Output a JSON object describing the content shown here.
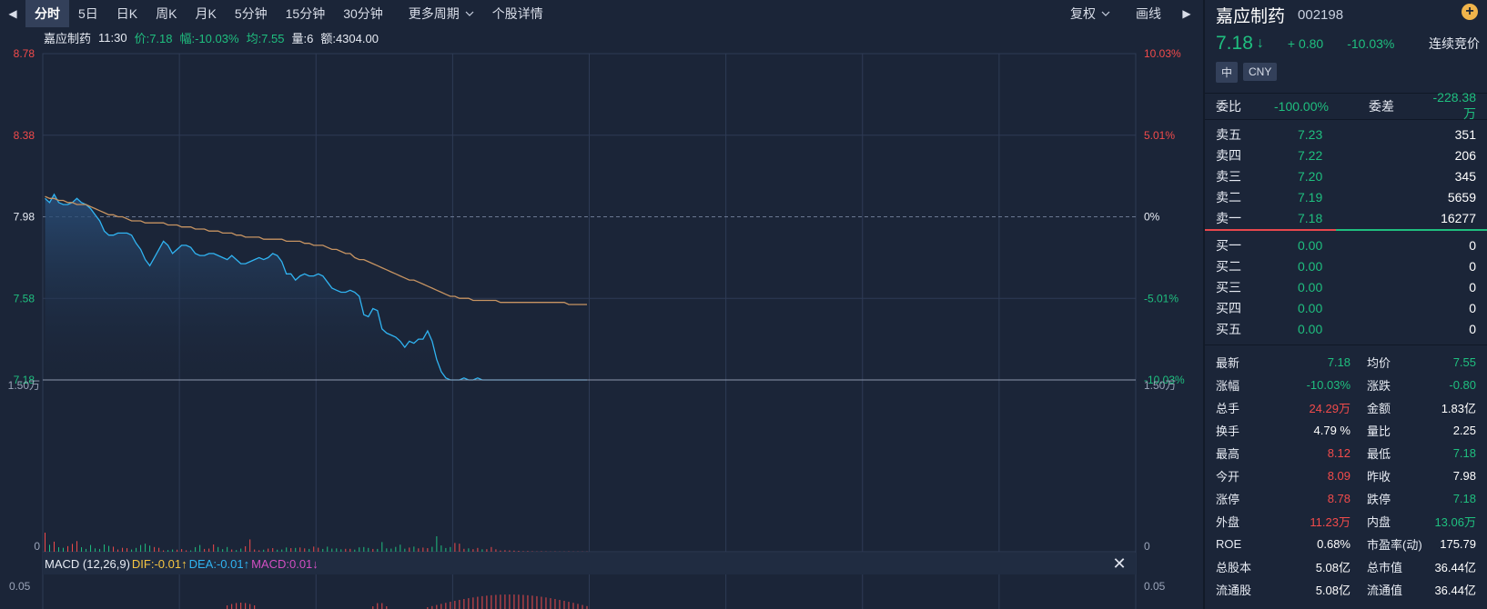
{
  "toolbar": {
    "prev_arrow": "◀",
    "tabs": [
      "分时",
      "5日",
      "日K",
      "周K",
      "月K",
      "5分钟",
      "15分钟",
      "30分钟"
    ],
    "active_tab": 0,
    "more_periods": "更多周期",
    "stock_detail": "个股详情",
    "adjust": "复权",
    "draw": "画线",
    "next_arrow": "▶"
  },
  "infoline": {
    "name": "嘉应制药",
    "time": "11:30",
    "price_label": "价:7.18",
    "change_label": "幅:-10.03%",
    "avg_label": "均:7.55",
    "vol_label": "量:6",
    "amount_label": "额:4304.00"
  },
  "chart_data": {
    "type": "line",
    "title": "",
    "price_axis": {
      "ticks": [
        "8.78",
        "8.38",
        "7.98",
        "7.58",
        "7.18"
      ],
      "tick_colors": [
        "#f24b4b",
        "#f24b4b",
        "#e7ebf3",
        "#1fbf7f",
        "#1fbf7f"
      ],
      "ylim": [
        7.18,
        8.78
      ],
      "prev_close": 7.98
    },
    "pct_axis": {
      "ticks": [
        "10.03%",
        "5.01%",
        "0%",
        "-5.01%",
        "-10.03%"
      ]
    },
    "volume_axis": {
      "ticks": [
        "1.50万",
        "0"
      ]
    },
    "macd_axis": {
      "ticks": [
        "0.05"
      ]
    },
    "x_session_minutes": 240,
    "series": [
      {
        "name": "价",
        "color": "#30b4f2",
        "values": [
          8.07,
          8.05,
          8.09,
          8.05,
          8.04,
          8.04,
          8.05,
          8.07,
          8.05,
          8.04,
          8.02,
          7.99,
          7.96,
          7.91,
          7.89,
          7.89,
          7.9,
          7.9,
          7.9,
          7.89,
          7.85,
          7.82,
          7.77,
          7.74,
          7.78,
          7.82,
          7.86,
          7.84,
          7.8,
          7.82,
          7.84,
          7.84,
          7.83,
          7.8,
          7.79,
          7.79,
          7.8,
          7.8,
          7.79,
          7.78,
          7.77,
          7.79,
          7.77,
          7.75,
          7.75,
          7.76,
          7.77,
          7.78,
          7.77,
          7.78,
          7.8,
          7.79,
          7.76,
          7.7,
          7.7,
          7.67,
          7.69,
          7.7,
          7.69,
          7.69,
          7.7,
          7.69,
          7.66,
          7.63,
          7.62,
          7.61,
          7.61,
          7.62,
          7.61,
          7.59,
          7.5,
          7.49,
          7.53,
          7.52,
          7.43,
          7.41,
          7.4,
          7.39,
          7.37,
          7.34,
          7.37,
          7.36,
          7.38,
          7.38,
          7.42,
          7.37,
          7.28,
          7.22,
          7.19,
          7.18,
          7.18,
          7.18,
          7.19,
          7.18,
          7.18,
          7.19,
          7.18,
          7.18,
          7.18,
          7.18,
          7.18,
          7.18,
          7.18,
          7.18,
          7.18,
          7.18,
          7.18,
          7.18,
          7.18,
          7.18,
          7.18,
          7.18,
          7.18,
          7.18,
          7.18,
          7.18,
          7.18,
          7.18,
          7.18,
          7.18
        ]
      },
      {
        "name": "均",
        "color": "#c79462",
        "values": [
          8.08,
          8.07,
          8.07,
          8.06,
          8.06,
          8.05,
          8.05,
          8.04,
          8.04,
          8.04,
          8.03,
          8.02,
          8.01,
          8.0,
          7.99,
          7.99,
          7.98,
          7.98,
          7.97,
          7.96,
          7.96,
          7.96,
          7.95,
          7.95,
          7.95,
          7.95,
          7.95,
          7.94,
          7.94,
          7.94,
          7.93,
          7.93,
          7.93,
          7.92,
          7.92,
          7.92,
          7.91,
          7.91,
          7.91,
          7.9,
          7.9,
          7.9,
          7.89,
          7.89,
          7.88,
          7.88,
          7.88,
          7.88,
          7.87,
          7.87,
          7.87,
          7.87,
          7.87,
          7.86,
          7.86,
          7.86,
          7.86,
          7.85,
          7.85,
          7.84,
          7.84,
          7.84,
          7.83,
          7.82,
          7.82,
          7.81,
          7.8,
          7.8,
          7.78,
          7.77,
          7.77,
          7.76,
          7.75,
          7.74,
          7.73,
          7.72,
          7.71,
          7.7,
          7.69,
          7.68,
          7.67,
          7.67,
          7.66,
          7.65,
          7.64,
          7.63,
          7.62,
          7.61,
          7.6,
          7.59,
          7.59,
          7.58,
          7.58,
          7.58,
          7.57,
          7.57,
          7.57,
          7.57,
          7.57,
          7.57,
          7.56,
          7.56,
          7.56,
          7.56,
          7.56,
          7.56,
          7.56,
          7.56,
          7.56,
          7.56,
          7.56,
          7.56,
          7.56,
          7.56,
          7.56,
          7.55,
          7.55,
          7.55,
          7.55,
          7.55
        ]
      }
    ],
    "volume": {
      "unit_max": 15000,
      "values": [
        1700,
        620,
        900,
        400,
        350,
        500,
        700,
        950,
        400,
        250,
        600,
        300,
        250,
        650,
        520,
        450,
        200,
        350,
        320,
        200,
        340,
        600,
        720,
        550,
        420,
        350,
        120,
        150,
        200,
        180,
        240,
        130,
        120,
        410,
        600,
        250,
        280,
        650,
        420,
        230,
        420,
        200,
        150,
        280,
        490,
        1100,
        200,
        130,
        180,
        280,
        320,
        180,
        200,
        380,
        320,
        340,
        380,
        300,
        250,
        460,
        360,
        250,
        450,
        280,
        300,
        220,
        260,
        260,
        190,
        390,
        420,
        340,
        250,
        250,
        860,
        300,
        280,
        430,
        630,
        270,
        370,
        460,
        300,
        370,
        320,
        440,
        1380,
        560,
        330,
        420,
        780,
        720,
        260,
        300,
        230,
        340,
        220,
        230,
        420,
        220,
        110,
        140,
        120,
        100,
        80,
        50,
        60,
        40,
        30,
        40,
        30,
        20,
        30,
        20,
        20,
        30,
        20,
        20,
        20,
        20
      ]
    },
    "macd": {
      "label": "MACD (12,26,9)",
      "dif": "DIF:-0.01↑",
      "dea": "DEA:-0.01↑",
      "macd": "MACD:0.01↓"
    },
    "grid": true
  },
  "panel": {
    "name": "嘉应制药",
    "code": "002198",
    "price": "7.18",
    "price_arrow": "↓",
    "change": "+ 0.80",
    "change_pct": "-10.03%",
    "status": "连续竞价",
    "tags": [
      "中",
      "CNY"
    ],
    "weibi_label": "委比",
    "weibi_value": "-100.00%",
    "weicha_label": "委差",
    "weicha_value": "-228.38万",
    "asks": [
      {
        "label": "卖五",
        "price": "7.23",
        "vol": "351"
      },
      {
        "label": "卖四",
        "price": "7.22",
        "vol": "206"
      },
      {
        "label": "卖三",
        "price": "7.20",
        "vol": "345"
      },
      {
        "label": "卖二",
        "price": "7.19",
        "vol": "5659"
      },
      {
        "label": "卖一",
        "price": "7.18",
        "vol": "16277"
      }
    ],
    "bids": [
      {
        "label": "买一",
        "price": "0.00",
        "vol": "0"
      },
      {
        "label": "买二",
        "price": "0.00",
        "vol": "0"
      },
      {
        "label": "买三",
        "price": "0.00",
        "vol": "0"
      },
      {
        "label": "买四",
        "price": "0.00",
        "vol": "0"
      },
      {
        "label": "买五",
        "price": "0.00",
        "vol": "0"
      }
    ],
    "stats": [
      {
        "l1": "最新",
        "v1": "7.18",
        "c1": "grn",
        "l2": "均价",
        "v2": "7.55",
        "c2": "grn"
      },
      {
        "l1": "涨幅",
        "v1": "-10.03%",
        "c1": "grn",
        "l2": "涨跌",
        "v2": "-0.80",
        "c2": "grn"
      },
      {
        "l1": "总手",
        "v1": "24.29万",
        "c1": "red",
        "l2": "金额",
        "v2": "1.83亿",
        "c2": "wht"
      },
      {
        "l1": "换手",
        "v1": "4.79 %",
        "c1": "wht",
        "l2": "量比",
        "v2": "2.25",
        "c2": "wht"
      },
      {
        "l1": "最高",
        "v1": "8.12",
        "c1": "red",
        "l2": "最低",
        "v2": "7.18",
        "c2": "grn"
      },
      {
        "l1": "今开",
        "v1": "8.09",
        "c1": "red",
        "l2": "昨收",
        "v2": "7.98",
        "c2": "wht"
      },
      {
        "l1": "涨停",
        "v1": "8.78",
        "c1": "red",
        "l2": "跌停",
        "v2": "7.18",
        "c2": "grn"
      },
      {
        "l1": "外盘",
        "v1": "11.23万",
        "c1": "red",
        "l2": "内盘",
        "v2": "13.06万",
        "c2": "grn"
      },
      {
        "l1": "ROE",
        "v1": "0.68%",
        "c1": "wht",
        "l2": "市盈率(动)",
        "v2": "175.79",
        "c2": "wht"
      },
      {
        "l1": "总股本",
        "v1": "5.08亿",
        "c1": "wht",
        "l2": "总市值",
        "v2": "36.44亿",
        "c2": "wht"
      },
      {
        "l1": "流通股",
        "v1": "5.08亿",
        "c1": "wht",
        "l2": "流通值",
        "v2": "36.44亿",
        "c2": "wht"
      }
    ]
  },
  "colors": {
    "background": "#1b2538",
    "grid": "#2e3b55",
    "red": "#f24b4b",
    "green": "#1fbf7f",
    "price_line": "#30b4f2",
    "avg_line": "#c79462"
  }
}
